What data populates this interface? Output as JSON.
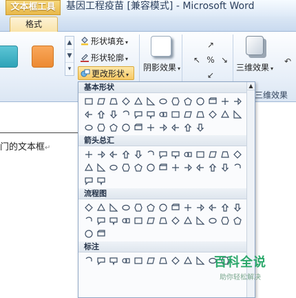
{
  "title_bar": {
    "context_group": "文本框工具",
    "window_title": "基因工程疫苗 [兼容模式] - Microsoft Word"
  },
  "tabs": [
    {
      "label": "格式",
      "active": true
    }
  ],
  "ribbon": {
    "shape_fill": "形状填充",
    "shape_outline": "形状轮廓",
    "change_shape": "更改形状",
    "shadow_effects": "阴影效果",
    "threed_effects": "三维效果",
    "threed_group_label": "三维效果",
    "style_colors": [
      "#3fb4c8",
      "#f39a44"
    ]
  },
  "document": {
    "visible_text": "门的文本框",
    "paragraph_mark": "↵"
  },
  "panel": {
    "sections": [
      {
        "label": "基本形状"
      },
      {
        "label": "箭头总汇"
      },
      {
        "label": "流程图"
      },
      {
        "label": "标注"
      }
    ]
  },
  "watermark": {
    "title": "百科全说",
    "subtitle": "助你轻松解决"
  },
  "colors": {
    "context_tab": "#e8b84a",
    "highlight": "#f8c965",
    "watermark": "#2aa86a"
  }
}
